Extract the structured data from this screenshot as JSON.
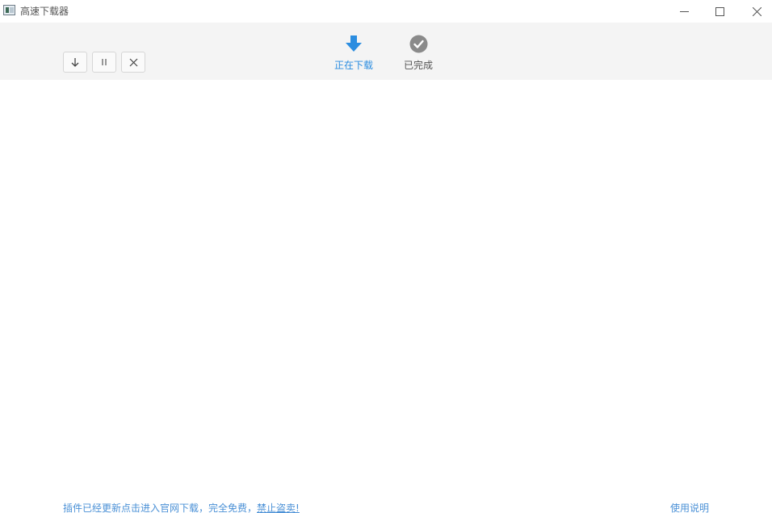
{
  "window": {
    "title": "高速下载器",
    "controls": {
      "minimize_icon": "minimize-icon",
      "maximize_icon": "maximize-icon",
      "close_icon": "close-icon"
    }
  },
  "toolbar": {
    "actions": [
      {
        "id": "download",
        "icon": "arrow-down-icon"
      },
      {
        "id": "pause",
        "icon": "pause-icon"
      },
      {
        "id": "cancel",
        "icon": "close-icon"
      }
    ],
    "tabs": [
      {
        "label": "正在下载",
        "icon": "download-arrow-icon",
        "active": true
      },
      {
        "label": "已完成",
        "icon": "check-circle-icon",
        "active": false
      }
    ]
  },
  "footer": {
    "notice_part1": "插件已经更新点击进入官网下载，完全免费，",
    "notice_part2": "禁止盗卖!",
    "help_link": "使用说明"
  },
  "colors": {
    "accent": "#2b8de0",
    "link": "#4a90d6",
    "toolbar_bg": "#f4f4f4",
    "completed_icon": "#8a8a8a"
  }
}
